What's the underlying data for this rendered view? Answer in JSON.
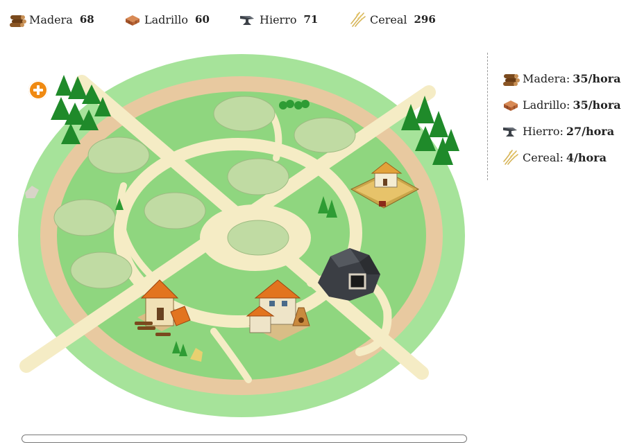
{
  "resources": [
    {
      "id": "madera",
      "name": "Madera",
      "amount": "68",
      "icon": "wood-logs-icon"
    },
    {
      "id": "ladrillo",
      "name": "Ladrillo",
      "amount": "60",
      "icon": "brick-stack-icon"
    },
    {
      "id": "hierro",
      "name": "Hierro",
      "amount": "71",
      "icon": "iron-anvil-icon"
    },
    {
      "id": "cereal",
      "name": "Cereal",
      "amount": "296",
      "icon": "wheat-icon"
    }
  ],
  "production": [
    {
      "label": "Madera:",
      "rate": "35/hora",
      "icon": "wood-logs-icon"
    },
    {
      "label": "Ladrillo:",
      "rate": "35/hora",
      "icon": "brick-stack-icon"
    },
    {
      "label": "Hierro:",
      "rate": "27/hora",
      "icon": "iron-anvil-icon"
    },
    {
      "label": "Cereal:",
      "rate": "4/hora",
      "icon": "wheat-icon"
    }
  ],
  "map": {
    "empty_plots": 8,
    "buildings": [
      "farm",
      "iron-mine",
      "sawmill",
      "brickworks"
    ],
    "add_button_icon": "plus-circle-icon"
  },
  "colors": {
    "grass_outer": "#a6e39a",
    "grass_inner": "#8fd67f",
    "ring_road": "#e8c9a0",
    "path": "#f5ecc5",
    "plot": "#c0dba3",
    "add_button": "#f08a12"
  }
}
